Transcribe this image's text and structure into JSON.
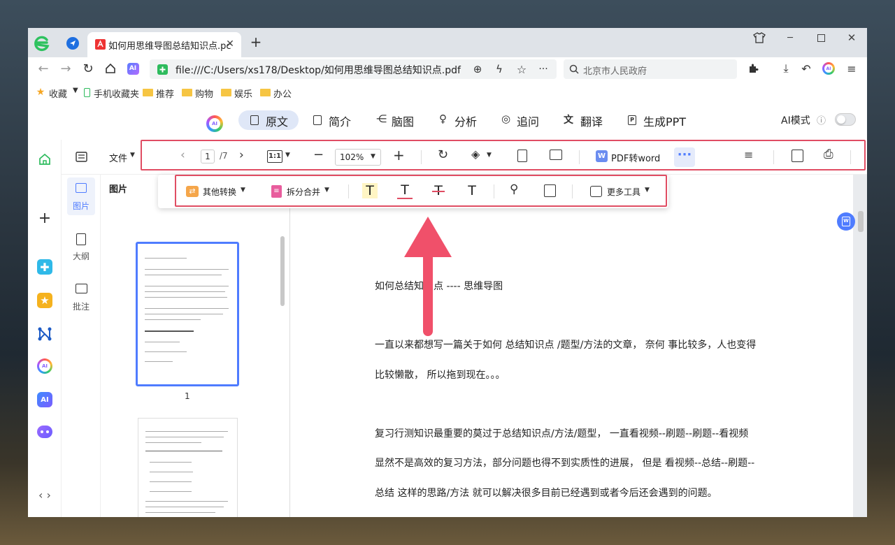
{
  "browser": {
    "tab_title": "如何用思维导图总结知识点.pc",
    "url": "file:///C:/Users/xs178/Desktop/如何用思维导图总结知识点.pdf",
    "search_placeholder": "北京市人民政府",
    "bookmarks": [
      "收藏",
      "手机收藏夹",
      "推荐",
      "购物",
      "娱乐",
      "办公"
    ]
  },
  "aibar": {
    "tabs": [
      "原文",
      "简介",
      "脑图",
      "分析",
      "追问",
      "翻译",
      "生成PPT"
    ],
    "ai_mode_label": "AI模式",
    "accent": "#4f7cff"
  },
  "toolbar": {
    "file_label": "文件",
    "page_current": "1",
    "page_total": "/7",
    "fit_label": "1:1",
    "zoom": "102%",
    "pdf_to_word": "PDF转word"
  },
  "popup": {
    "other_convert": "其他转换",
    "split_merge": "拆分合并",
    "more_tools": "更多工具"
  },
  "side_panel": {
    "items": [
      "图片",
      "大纲",
      "批注"
    ],
    "thumbs_title": "图片",
    "page_num": "1"
  },
  "document": {
    "paragraphs": [
      "如何总结知识点 ---- 思维导图",
      "一直以来都想写一篇关于如何 总结知识点 /题型/方法的文章， 奈何 事比较多，人也变得",
      "比较懒散， 所以拖到现在。。。",
      "复习行测知识最重要的莫过于总结知识点/方法/题型， 一直看视频--刷题--刷题--看视频",
      "显然不是高效的复习方法，部分问题也得不到实质性的进展， 但是 看视频--总结--刷题--",
      "总结 这样的思路/方法 就可以解决很多目前已经遇到或者今后还会遇到的问题。"
    ]
  },
  "colors": {
    "highlight_red": "#e04d63",
    "arrow": "#f0506a"
  }
}
